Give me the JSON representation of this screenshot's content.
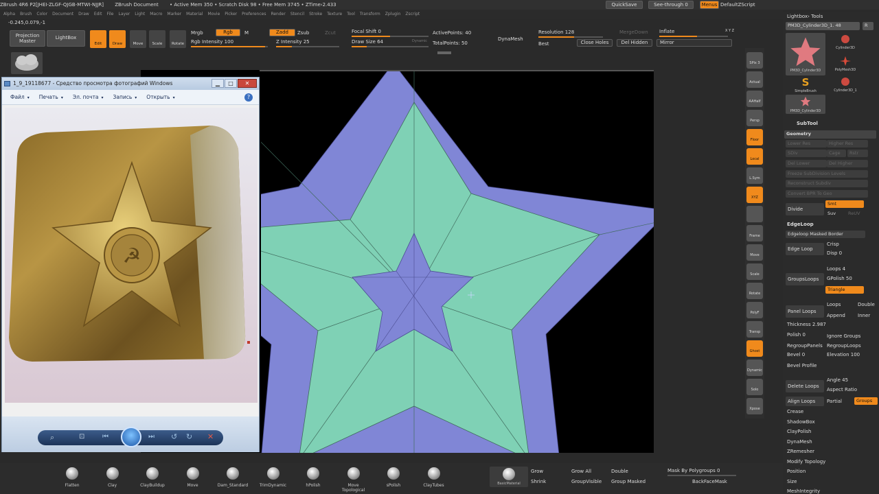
{
  "titlebar": {
    "items": [
      "ZBrush 4R6 P2[JHEI-ZLGF-QJGB-MTWI-NJJR]",
      "ZBrush Document",
      "• Active Mem 350 • Scratch Disk 98 • Free Mem 3745 • ZTime›2.433"
    ],
    "quicksave": "QuickSave",
    "seethrough": "See-through 0",
    "menus": "Menus",
    "defaultzscript": "DefaultZScript"
  },
  "menubar": [
    "Alpha",
    "Brush",
    "Color",
    "Document",
    "Draw",
    "Edit",
    "File",
    "Layer",
    "Light",
    "Macro",
    "Marker",
    "Material",
    "Movie",
    "Picker",
    "Preferences",
    "Render",
    "Stencil",
    "Stroke",
    "Texture",
    "Tool",
    "Transform",
    "Zplugin",
    "Zscript"
  ],
  "coords": "-0.245,0.079,-1",
  "toolbar": {
    "projection_master": "Projection Master",
    "lightbox": "LightBox",
    "edit": "Edit",
    "draw": "Draw",
    "move": "Move",
    "scale": "Scale",
    "rotate": "Rotate",
    "mrgb": "Mrgb",
    "rgb": "Rgb",
    "m": "M",
    "rgb_intensity": "Rgb Intensity 100",
    "zadd": "Zadd",
    "zsub": "Zsub",
    "zcut": "Zcut",
    "z_intensity": "Z Intensity 25",
    "focal_shift": "Focal Shift 0",
    "draw_size": "Draw Size 64",
    "dynamic": "Dynamic",
    "active_points": "ActivePoints: 40",
    "total_points": "TotalPoints: 50",
    "dynamesh": "DynaMesh",
    "resolution": "Resolution 128",
    "best": "Best",
    "mergedown": "MergeDown",
    "close_holes": "Close Holes",
    "del_hidden": "Del Hidden",
    "inflate": "Inflate",
    "mirror": "Mirror",
    "xyz": "X Y Z"
  },
  "right_shelf": [
    "SPix 3",
    "Actual",
    "AAHalf",
    "Persp",
    "Floor",
    "Local",
    "L.Sym",
    "XYZ",
    "",
    "Frame",
    "Move",
    "Scale",
    "Rotate",
    "PolyF",
    "Transp",
    "Ghost",
    "Dynamic",
    "Solo",
    "Xpose"
  ],
  "right_panel": {
    "lightbox_tools": "Lightbox› Tools",
    "current_tool": "PM3D_Cylinder3D_1. 48",
    "r_btn": "R",
    "tools": [
      {
        "label": "PM3D_Cylinder3D",
        "icon": "star"
      },
      {
        "label": "Cylinder3D",
        "icon": "sphere"
      },
      {
        "label": "PolyMesh3D",
        "icon": "polymesh"
      },
      {
        "label": "SimpleBrush",
        "icon": "simplebrush"
      },
      {
        "label": "Cylinder3D_1",
        "icon": "sphere"
      },
      {
        "label": "PM3D_Cylinder3D",
        "icon": "star"
      }
    ],
    "subtool": "SubTool",
    "geometry": "Geometry",
    "lower_res": "Lower Res",
    "higher_res": "Higher Res",
    "sdiv": "SDiv",
    "cage": "Cage",
    "rstr": "Rstr",
    "del_lower": "Del Lower",
    "del_higher": "Del Higher",
    "freeze": "Freeze SubDivision Levels",
    "reconstruct": "Reconstruct Subdiv",
    "convert": "Convert BPR To Geo",
    "divide": "Divide",
    "smt": "Smt",
    "suv": "Suv",
    "reuv": "ReUV",
    "edgeloop": "EdgeLoop",
    "edgeloop_masked": "Edgeloop Masked Border",
    "edge_loop": "Edge Loop",
    "crisp": "Crisp",
    "disp": "Disp 0",
    "groupsloops": "GroupsLoops",
    "loops": "Loops 4",
    "gpolish": "GPolish 50",
    "triangle": "Triangle",
    "panel_loops": "Panel Loops",
    "loops2": "Loops",
    "double": "Double",
    "append": "Append",
    "inner": "Inner",
    "thickness": "Thickness 2.987",
    "polish": "Polish 0",
    "ignore_groups": "Ignore Groups",
    "regroup_panels": "RegroupPanels",
    "regroup_loops": "RegroupLoops",
    "bevel": "Bevel 0",
    "elevation": "Elevation 100",
    "bevel_profile": "Bevel Profile",
    "delete_loops": "Delete Loops",
    "angle": "Angle 45",
    "aspect_ratio": "Aspect Ratio",
    "align_loops": "Align Loops",
    "partial": "Partial",
    "groups": "Groups",
    "sections": [
      "Crease",
      "ShadowBox",
      "ClayPolish",
      "DynaMesh",
      "ZRemesher",
      "Modify Topology",
      "Position",
      "Size",
      "MeshIntegrity"
    ]
  },
  "photo_viewer": {
    "title": "1_9_19118677 - Средство просмотра фотографий Windows",
    "menu": [
      "Файл",
      "Печать",
      "Эл. почта",
      "Запись",
      "Открыть"
    ]
  },
  "bottombar": {
    "brushes": [
      "Flatten",
      "Clay",
      "ClayBuildup",
      "Move",
      "Dam_Standard",
      "TrimDynamic",
      "hPolish",
      "Move Topological",
      "sPolish",
      "ClayTubes"
    ],
    "material": "BasicMaterial",
    "grow": "Grow",
    "grow_all": "Grow All",
    "double": "Double",
    "shrink": "Shrink",
    "group_visible": "GroupVisible",
    "group_masked": "Group Masked",
    "mask_by_polygroups": "Mask By Polygroups 0",
    "backface_mask": "BackFaceMask"
  },
  "colors": {
    "accent": "#f08a1c",
    "star_outer": "#8086d6",
    "star_mid": "#7fd1b5"
  }
}
